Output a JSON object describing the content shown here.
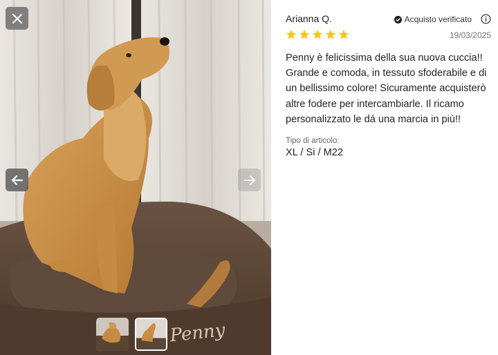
{
  "review": {
    "reviewer_name": "Arianna Q.",
    "verified_label": "Acquisto verificato",
    "rating": 5,
    "rating_max": 5,
    "date": "19/03/2025",
    "body": "Penny è felicissima della sua nuova cuccia!! Grande e comoda, in tessuto sfoderabile e di un bellissimo colore! Sicuramente acquisterò altre fodere per intercambiarle. Il ricamo personalizzato le dá una marcia in più!!",
    "variant_label": "Tipo di articolo:",
    "variant_value": "XL / Si / M22"
  },
  "gallery": {
    "bed_embroidery": "Penny",
    "thumbnails_count": 2,
    "active_thumbnail": 2
  },
  "icons": {
    "close": "close-icon",
    "prev": "arrow-left-icon",
    "next": "arrow-right-icon",
    "verified": "check-circle-icon",
    "info": "info-icon",
    "star": "star-icon"
  },
  "colors": {
    "star": "#f5c518",
    "bed": "#5b4535",
    "dog": "#c98d45"
  }
}
